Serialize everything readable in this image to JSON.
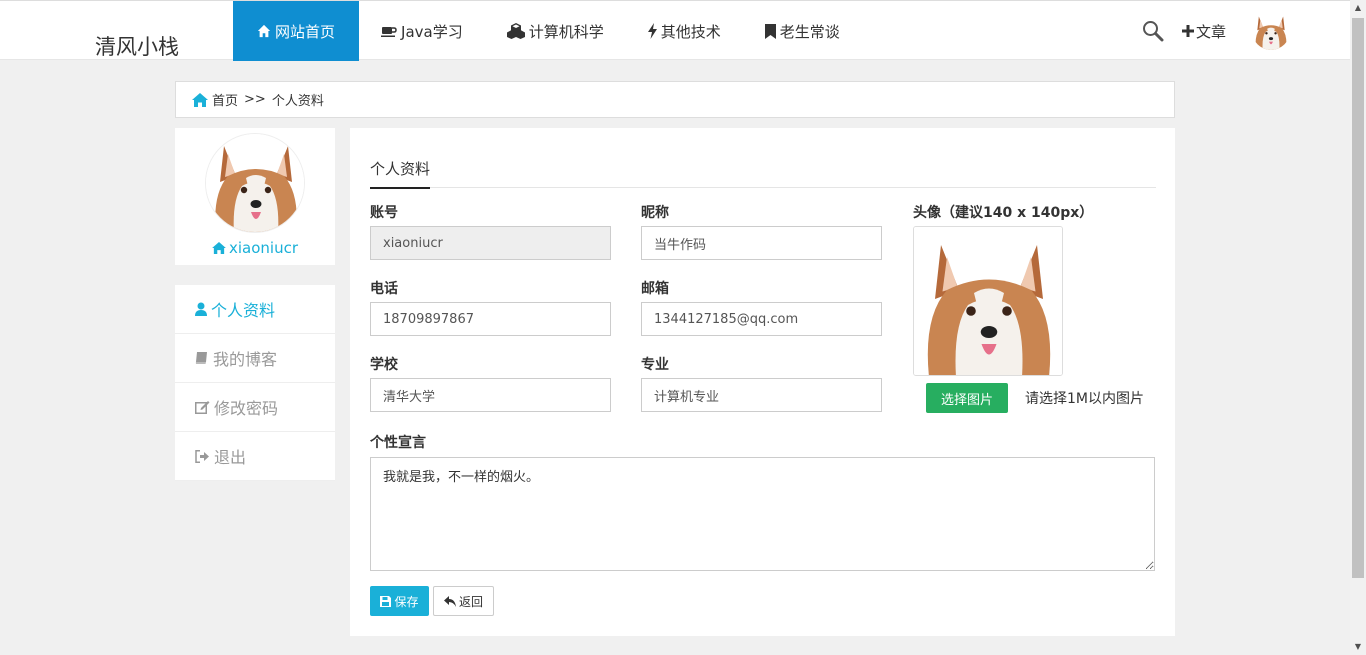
{
  "brand": "清风小栈",
  "nav": {
    "items": [
      {
        "label": "网站首页",
        "icon": "home-icon"
      },
      {
        "label": "Java学习",
        "icon": "coffee-icon"
      },
      {
        "label": "计算机科学",
        "icon": "cubes-icon"
      },
      {
        "label": "其他技术",
        "icon": "bolt-icon"
      },
      {
        "label": "老生常谈",
        "icon": "bookmark-icon"
      }
    ],
    "new_article": "文章"
  },
  "breadcrumb": {
    "home": "首页",
    "sep": ">>",
    "current": "个人资料"
  },
  "profile": {
    "username": "xiaoniucr"
  },
  "side_menu": [
    {
      "label": "个人资料",
      "icon": "user-icon"
    },
    {
      "label": "我的博客",
      "icon": "book-icon"
    },
    {
      "label": "修改密码",
      "icon": "edit-icon"
    },
    {
      "label": "退出",
      "icon": "sign-out-icon"
    }
  ],
  "form": {
    "tab": "个人资料",
    "account": {
      "label": "账号",
      "value": "xiaoniucr"
    },
    "nickname": {
      "label": "昵称",
      "value": "当牛作码"
    },
    "phone": {
      "label": "电话",
      "value": "18709897867"
    },
    "email": {
      "label": "邮箱",
      "value": "1344127185@qq.com"
    },
    "school": {
      "label": "学校",
      "value": "清华大学"
    },
    "major": {
      "label": "专业",
      "value": "计算机专业"
    },
    "avatar": {
      "label": "头像（建议140 x 140px）",
      "button": "选择图片",
      "hint": "请选择1M以内图片"
    },
    "bio": {
      "label": "个性宣言",
      "value": "我就是我，不一样的烟火。"
    },
    "save": "保存",
    "back": "返回"
  },
  "colors": {
    "primary": "#0f8ed1",
    "accent": "#1ab0d8",
    "success": "#27ae60"
  }
}
